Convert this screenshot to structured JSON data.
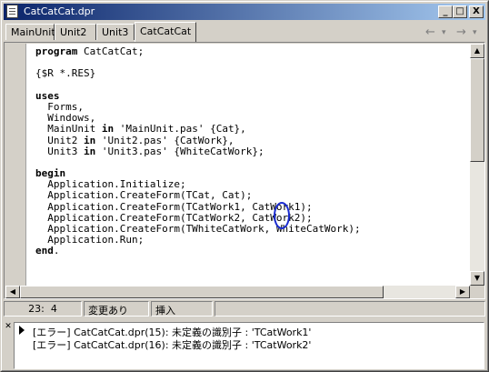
{
  "window": {
    "title": "CatCatCat.dpr",
    "buttons": {
      "minimize": "_",
      "maximize": "□",
      "close": "X"
    }
  },
  "tabs": [
    {
      "label": "MainUnit",
      "active": false
    },
    {
      "label": "Unit2",
      "active": false
    },
    {
      "label": "Unit3",
      "active": false
    },
    {
      "label": "CatCatCat",
      "active": true
    }
  ],
  "nav": {
    "back_icon": "←",
    "back_dropdown": "▾",
    "forward_icon": "→",
    "forward_dropdown": "▾"
  },
  "code": {
    "lines": [
      [
        {
          "t": "program",
          "k": true
        },
        {
          "t": " CatCatCat;"
        }
      ],
      [
        {
          "t": ""
        }
      ],
      [
        {
          "t": "{$R *.RES}"
        }
      ],
      [
        {
          "t": ""
        }
      ],
      [
        {
          "t": "uses",
          "k": true
        }
      ],
      [
        {
          "t": "  Forms,"
        }
      ],
      [
        {
          "t": "  Windows,"
        }
      ],
      [
        {
          "t": "  MainUnit "
        },
        {
          "t": "in",
          "k": true
        },
        {
          "t": " 'MainUnit.pas' {Cat},"
        }
      ],
      [
        {
          "t": "  Unit2 "
        },
        {
          "t": "in",
          "k": true
        },
        {
          "t": " 'Unit2.pas' {CatWork},"
        }
      ],
      [
        {
          "t": "  Unit3 "
        },
        {
          "t": "in",
          "k": true
        },
        {
          "t": " 'Unit3.pas' {WhiteCatWork};"
        }
      ],
      [
        {
          "t": ""
        }
      ],
      [
        {
          "t": "begin",
          "k": true
        }
      ],
      [
        {
          "t": "  Application.Initialize;"
        }
      ],
      [
        {
          "t": "  Application.CreateForm(TCat, Cat);"
        }
      ],
      [
        {
          "t": "  Application.CreateForm(TCatWork1, CatWork1);"
        }
      ],
      [
        {
          "t": "  Application.CreateForm(TCatWork2, CatWork2);"
        }
      ],
      [
        {
          "t": "  Application.CreateForm(TWhiteCatWork, WhiteCatWork);"
        }
      ],
      [
        {
          "t": "  Application.Run;"
        }
      ],
      [
        {
          "t": "end",
          "k": true
        },
        {
          "t": "."
        }
      ]
    ]
  },
  "status": {
    "position": "23:  4",
    "modified": "変更あり",
    "mode": "挿入"
  },
  "messages": [
    "[エラー] CatCatCat.dpr(15): 未定義の識別子 : 'TCatWork1'",
    "[エラー] CatCatCat.dpr(16): 未定義の識別子 : 'TCatWork2'"
  ],
  "colors": {
    "titlebar_start": "#0a246a",
    "titlebar_end": "#a6caf0",
    "marker": "#1a2bd0",
    "face": "#d4d0c8"
  }
}
